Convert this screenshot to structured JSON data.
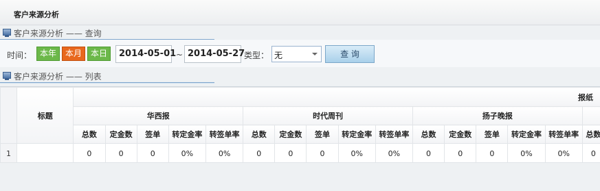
{
  "page": {
    "title": "客户来源分析"
  },
  "query_section": {
    "label": "客户来源分析 —— 查询"
  },
  "list_section": {
    "label": "客户来源分析 —— 列表"
  },
  "query": {
    "time_label": "时间：",
    "buttons": {
      "year": "本年",
      "month": "本月",
      "day": "本日"
    },
    "start_date": "2014-05-01",
    "separator": "~",
    "end_date": "2014-05-27",
    "type_label": "类型：",
    "type_value": "无",
    "search_label": "查 询"
  },
  "table": {
    "top_group": "报纸",
    "title_header": "标题",
    "groups": [
      "华西报",
      "时代周刊",
      "扬子晚报"
    ],
    "sub_headers": [
      "总数",
      "定金数",
      "签单",
      "转定金率",
      "转签单率"
    ],
    "partial_header": "总数",
    "rows": [
      {
        "num": "1",
        "title": "",
        "cells": [
          "0",
          "0",
          "0",
          "0%",
          "0%",
          "0",
          "0",
          "0",
          "0%",
          "0%",
          "0",
          "0",
          "0",
          "0%",
          "0%",
          "0"
        ]
      }
    ]
  },
  "colors": {
    "year_btn": "#6cb84a",
    "month_btn": "#e8681e",
    "day_btn": "#6cb84a",
    "section_line": "#7fa6cc"
  }
}
